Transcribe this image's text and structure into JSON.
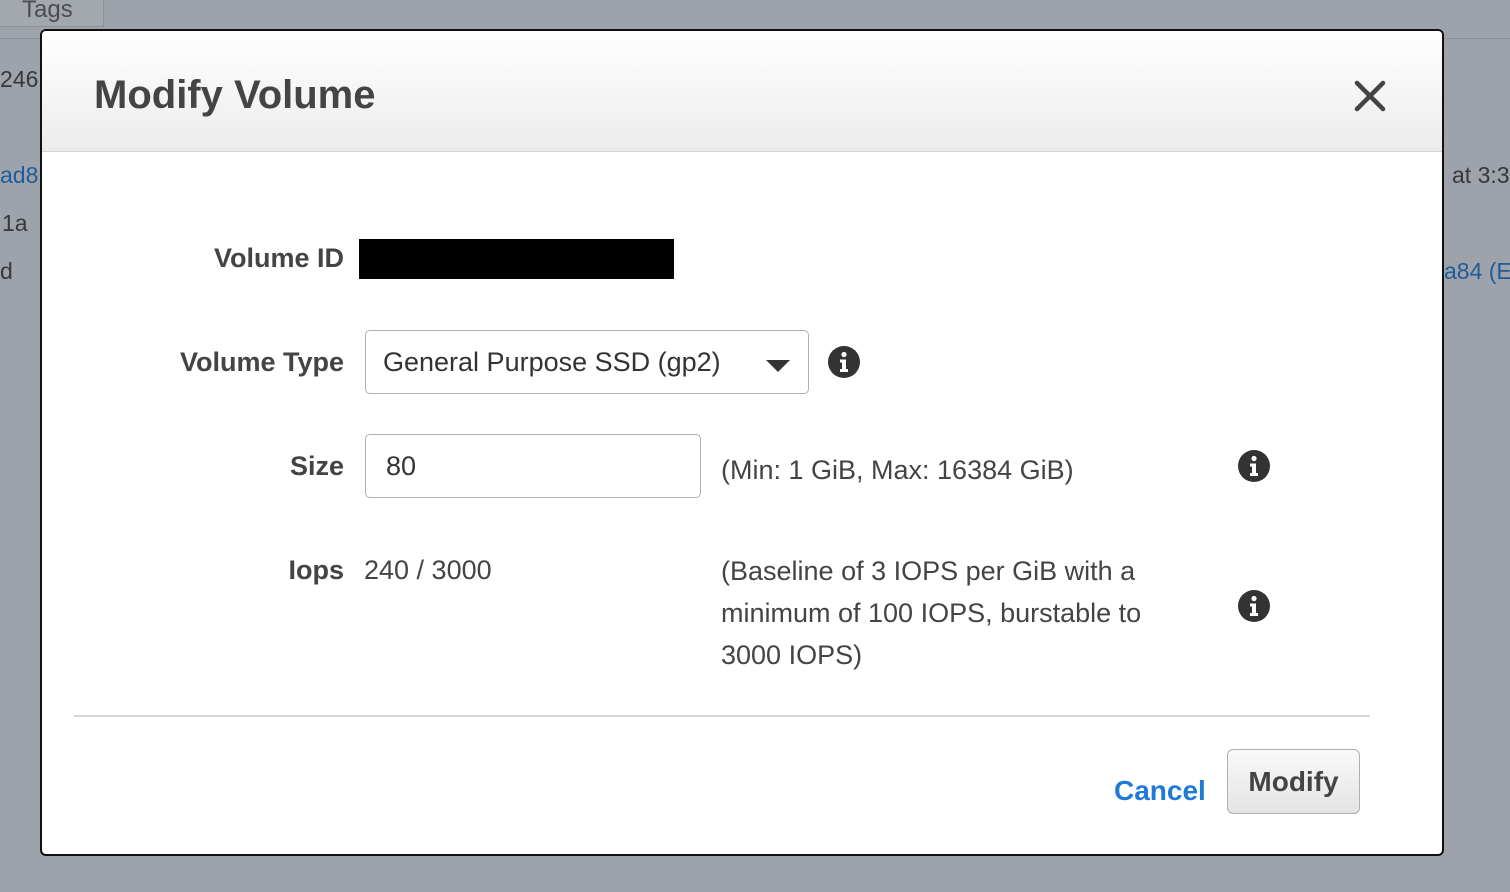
{
  "background": {
    "tab_label": "Tags",
    "left_fragments": [
      "246",
      "ad8",
      "1a",
      "d"
    ],
    "right_fragments": [
      "at 3:3",
      "a84 (E"
    ]
  },
  "dialog": {
    "title": "Modify Volume",
    "close_icon": "close-icon",
    "fields": {
      "volume_id": {
        "label": "Volume ID",
        "value_redacted": true
      },
      "volume_type": {
        "label": "Volume Type",
        "selected": "General Purpose SSD (gp2)",
        "info_icon": "info-icon"
      },
      "size": {
        "label": "Size",
        "value": "80",
        "hint": "(Min: 1 GiB, Max: 16384 GiB)",
        "info_icon": "info-icon"
      },
      "iops": {
        "label": "Iops",
        "value": "240 / 3000",
        "hint": "(Baseline of 3 IOPS per GiB with a minimum of 100 IOPS, burstable to 3000 IOPS)",
        "info_icon": "info-icon"
      }
    },
    "footer": {
      "cancel_label": "Cancel",
      "modify_label": "Modify"
    }
  },
  "colors": {
    "overlay": "#9ea3ab",
    "link": "#1f7ad4",
    "text": "#444444"
  }
}
